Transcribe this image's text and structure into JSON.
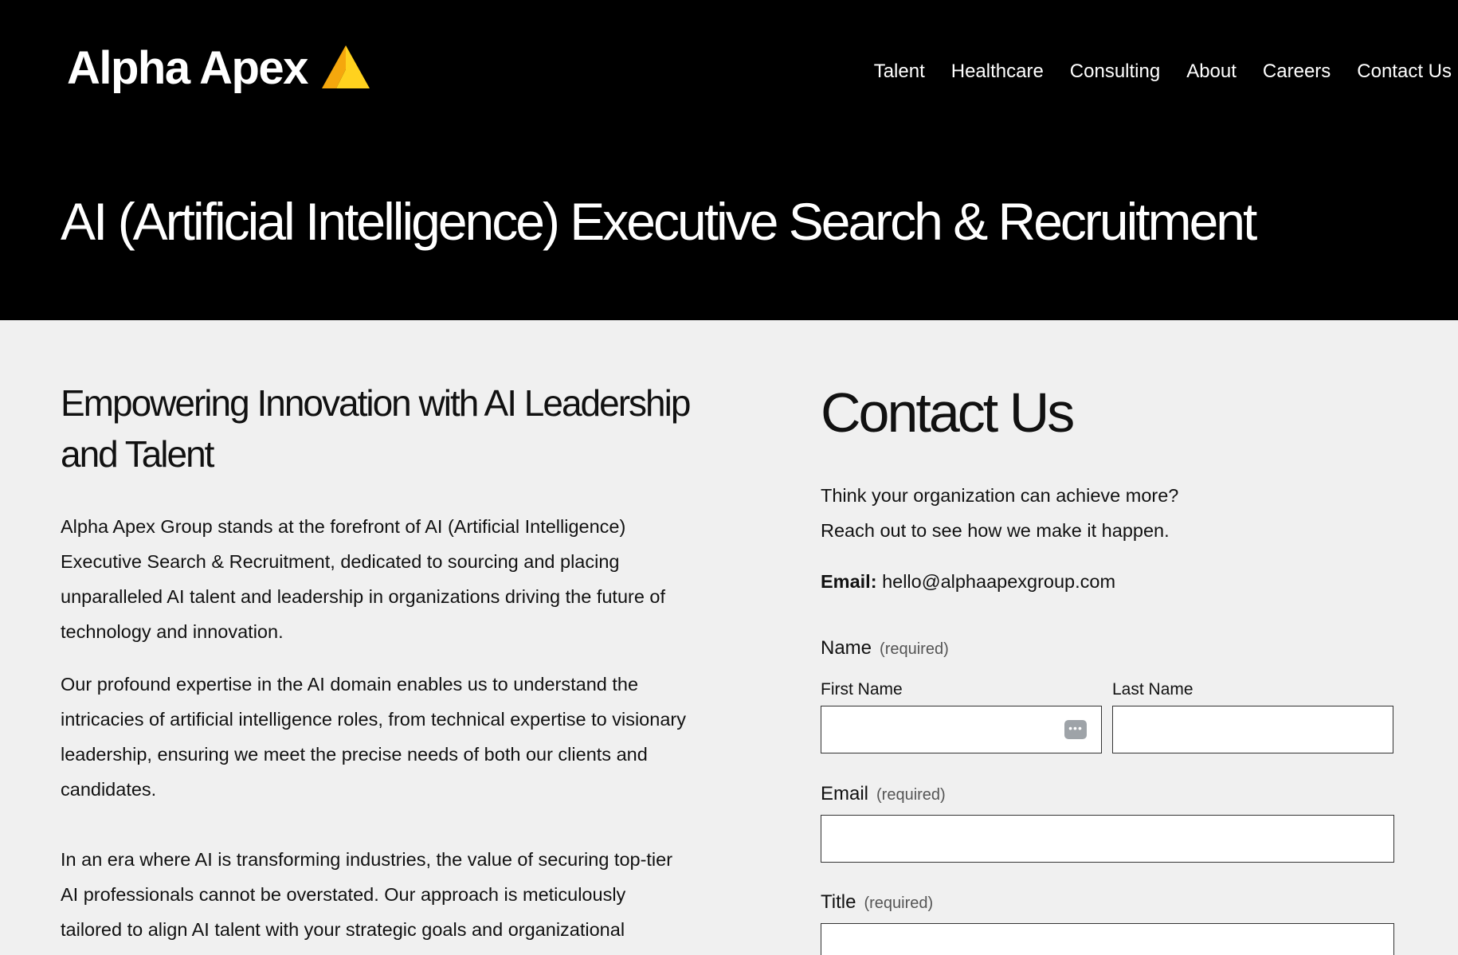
{
  "brand": {
    "name": "Alpha Apex",
    "mark_colors": {
      "left": "#f5a70d",
      "right": "#ffd21e"
    }
  },
  "nav": {
    "items": [
      "Talent",
      "Healthcare",
      "Consulting",
      "About",
      "Careers",
      "Contact Us"
    ]
  },
  "hero": {
    "title": "AI (Artificial Intelligence) Executive Search & Recruitment"
  },
  "main": {
    "heading": "Empowering Innovation with AI Leadership and Talent",
    "paragraphs": [
      "Alpha Apex Group stands at the forefront of AI (Artificial Intelligence) Executive Search & Recruitment, dedicated to sourcing and placing unparalleled AI talent and leadership in organizations driving the future of technology and innovation.",
      "Our profound expertise in the AI domain enables us to understand the intricacies of artificial intelligence roles, from technical expertise to visionary leadership, ensuring we meet the precise needs of both our clients and candidates.",
      "In an era where AI is transforming industries, the value of securing top-tier AI professionals cannot be overstated. Our approach is meticulously tailored to align AI talent with your strategic goals and organizational"
    ]
  },
  "contact": {
    "heading": "Contact Us",
    "intro_line1": "Think your organization can achieve more?",
    "intro_line2": "Reach out to see how we make it happen.",
    "email_label": "Email:",
    "email_value": "hello@alphaapexgroup.com",
    "form": {
      "name_label": "Name",
      "required_text": "(required)",
      "first_name_label": "First Name",
      "last_name_label": "Last Name",
      "first_name_value": "",
      "last_name_value": "",
      "email_label": "Email",
      "email_value": "",
      "title_label": "Title",
      "title_value": ""
    }
  }
}
